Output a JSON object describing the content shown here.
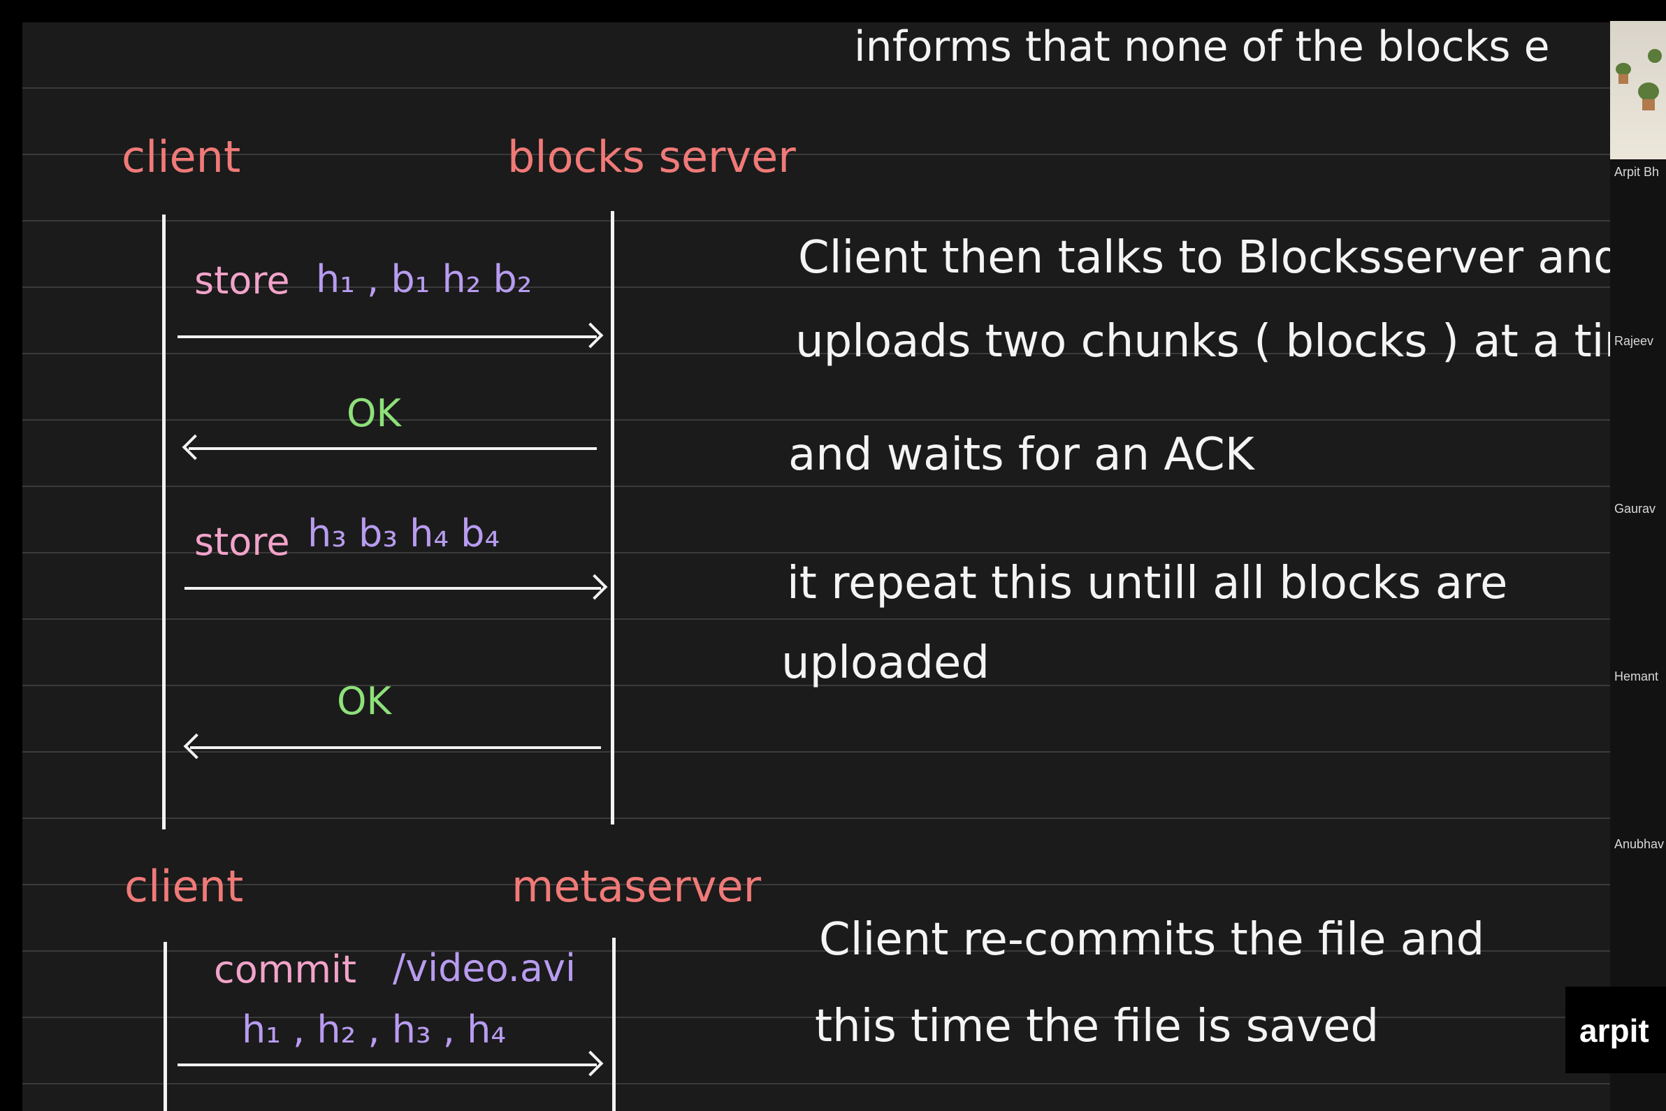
{
  "top_fragment": "informs that none of the blocks e",
  "diagram1": {
    "left_label": "client",
    "right_label": "blocks server",
    "msg1": {
      "cmd": "store",
      "args": "h₁ , b₁   h₂ b₂"
    },
    "ack1": "OK",
    "msg2": {
      "cmd": "store",
      "args": "h₃ b₃   h₄ b₄"
    },
    "ack2": "OK"
  },
  "notes1": {
    "line1": "Client then talks to Blocksserver and",
    "line2": "uploads two chunks ( blocks ) at a time",
    "line3": "and waits for an ACK",
    "line4": "it repeat this untill all blocks are",
    "line5": "uploaded"
  },
  "diagram2": {
    "left_label": "client",
    "right_label": "metaserver",
    "msg_cmd": "commit",
    "msg_path": "/video.avi",
    "msg_hashes": "h₁ , h₂ , h₃ , h₄"
  },
  "notes2": {
    "line1": "Client re-commits the file and",
    "line2": "this time the file is saved"
  },
  "participants": {
    "speaker": "Arpit Bh",
    "others": [
      "Rajeev",
      "Gaurav",
      "Hemant",
      "Anubhav"
    ]
  },
  "brand": "arpit"
}
